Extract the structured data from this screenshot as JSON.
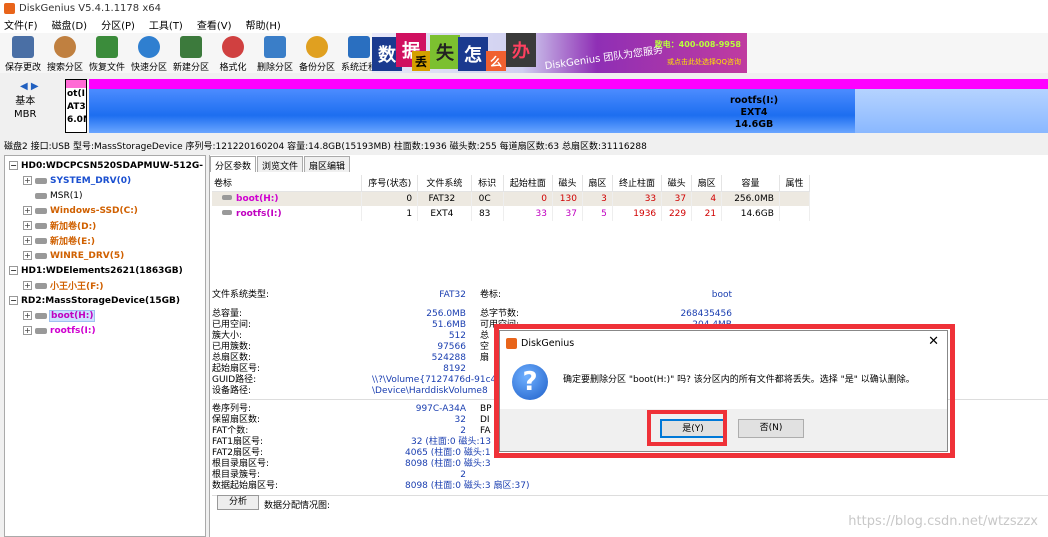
{
  "window": {
    "title": "DiskGenius V5.4.1.1178 x64"
  },
  "menu": [
    "文件(F)",
    "磁盘(D)",
    "分区(P)",
    "工具(T)",
    "查看(V)",
    "帮助(H)"
  ],
  "toolbar": [
    {
      "label": "保存更改",
      "icon": "save-icon",
      "color": "#4a6fa5"
    },
    {
      "label": "搜索分区",
      "icon": "search-icon",
      "color": "#c08040"
    },
    {
      "label": "恢复文件",
      "icon": "recover-icon",
      "color": "#3b8c3b"
    },
    {
      "label": "快速分区",
      "icon": "quick-partition-icon",
      "color": "#2f7fd0"
    },
    {
      "label": "新建分区",
      "icon": "new-partition-icon",
      "color": "#3c7a3c"
    },
    {
      "label": "格式化",
      "icon": "format-icon",
      "color": "#d04040"
    },
    {
      "label": "删除分区",
      "icon": "delete-partition-icon",
      "color": "#3a7ec8"
    },
    {
      "label": "备份分区",
      "icon": "backup-icon",
      "color": "#e0a020"
    },
    {
      "label": "系统迁移",
      "icon": "migrate-icon",
      "color": "#2a6fc0"
    }
  ],
  "banner": {
    "chars": [
      "数",
      "据",
      "丢",
      "失",
      "怎",
      "么",
      "办"
    ],
    "slogan": "DiskGenius 团队为您服务",
    "phone": "致电：400-008-9958",
    "qq": "或点击此处选择QQ咨询"
  },
  "diskmap": {
    "nav": "◀ ▶",
    "type_line1": "基本",
    "type_line2": "MBR",
    "boot_text": [
      "ot(I",
      "AT3",
      "6.0M"
    ],
    "root_name": "rootfs(I:)",
    "root_fs": "EXT4",
    "root_size": "14.6GB"
  },
  "diskinfo": "磁盘2 接口:USB  型号:MassStorageDevice  序列号:121220160204  容量:14.8GB(15193MB)  柱面数:1936  磁头数:255  每道扇区数:63  总扇区数:31116288",
  "tree": [
    {
      "label": "HD0:WDCPCSN520SDAPMUW-512G-",
      "level": 0,
      "disk": true,
      "color": "#000000"
    },
    {
      "label": "SYSTEM_DRV(0)",
      "level": 1,
      "color": "#1a4fd0"
    },
    {
      "label": "MSR(1)",
      "level": 1,
      "color": "#000000"
    },
    {
      "label": "Windows-SSD(C:)",
      "level": 1,
      "color": "#d06000"
    },
    {
      "label": "新加卷(D:)",
      "level": 1,
      "color": "#d06000"
    },
    {
      "label": "新加卷(E:)",
      "level": 1,
      "color": "#d06000"
    },
    {
      "label": "WINRE_DRV(5)",
      "level": 1,
      "color": "#d06000"
    },
    {
      "label": "HD1:WDElements2621(1863GB)",
      "level": 0,
      "disk": true,
      "color": "#000000"
    },
    {
      "label": "小王小王(F:)",
      "level": 1,
      "color": "#d06000"
    },
    {
      "label": "RD2:MassStorageDevice(15GB)",
      "level": 0,
      "disk": true,
      "color": "#000000"
    },
    {
      "label": "boot(H:)",
      "level": 1,
      "color": "#c000c0",
      "selected": true
    },
    {
      "label": "rootfs(I:)",
      "level": 1,
      "color": "#d000d0"
    }
  ],
  "tabs": [
    "分区参数",
    "浏览文件",
    "扇区编辑"
  ],
  "table": {
    "headers": [
      "卷标",
      "序号(状态)",
      "文件系统",
      "标识",
      "起始柱面",
      "磁头",
      "扇区",
      "终止柱面",
      "磁头",
      "扇区",
      "容量",
      "属性"
    ],
    "rows": [
      [
        "boot(H:)",
        "0",
        "FAT32",
        "0C",
        "0",
        "130",
        "3",
        "33",
        "37",
        "4",
        "256.0MB",
        ""
      ],
      [
        "rootfs(I:)",
        "1",
        "EXT4",
        "83",
        "33",
        "37",
        "5",
        "1936",
        "229",
        "21",
        "14.6GB",
        ""
      ]
    ]
  },
  "details": {
    "fstype_label": "文件系统类型:",
    "fstype_value": "FAT32",
    "vol_label": "卷标:",
    "vol_value": "boot",
    "left": [
      [
        "总容量:",
        "256.0MB"
      ],
      [
        "已用空间:",
        "51.6MB"
      ],
      [
        "簇大小:",
        "512"
      ],
      [
        "已用簇数:",
        "97566"
      ],
      [
        "总扇区数:",
        "524288"
      ],
      [
        "起始扇区号:",
        "8192"
      ],
      [
        "GUID路径:",
        "\\\\?\\Volume{7127476d-91c4"
      ],
      [
        "设备路径:",
        "\\Device\\HarddiskVolume8"
      ]
    ],
    "right": [
      [
        "总字节数:",
        "268435456"
      ],
      [
        "可用空间:",
        "204.4MB"
      ],
      [
        "总",
        ""
      ],
      [
        "空",
        ""
      ],
      [
        "扇",
        ""
      ]
    ],
    "left2": [
      [
        "卷序列号:",
        "997C-A34A"
      ],
      [
        "保留扇区数:",
        "32"
      ],
      [
        "FAT个数:",
        "2"
      ],
      [
        "FAT1扇区号:",
        "32 (柱面:0 磁头:13"
      ],
      [
        "FAT2扇区号:",
        "4065 (柱面:0 磁头:1"
      ],
      [
        "根目录扇区号:",
        "8098 (柱面:0 磁头:3"
      ],
      [
        "根目录簇号:",
        "2"
      ],
      [
        "数据起始扇区号:",
        "8098 (柱面:0 磁头:3 扇区:37)"
      ]
    ],
    "right2": [
      "BP",
      "DI",
      "FA"
    ],
    "analyze_button": "分析",
    "analyze_label": "数据分配情况图:"
  },
  "dialog": {
    "title": "DiskGenius",
    "message": "确定要删除分区 \"boot(H:)\" 吗? 该分区内的所有文件都将丢失。选择 \"是\" 以确认删除。",
    "yes": "是(Y)",
    "no": "否(N)",
    "close": "✕"
  },
  "watermark": "https://blog.csdn.net/wtzszzx",
  "colors": {
    "highlight": "#ef3138",
    "accent": "#0078d7"
  }
}
